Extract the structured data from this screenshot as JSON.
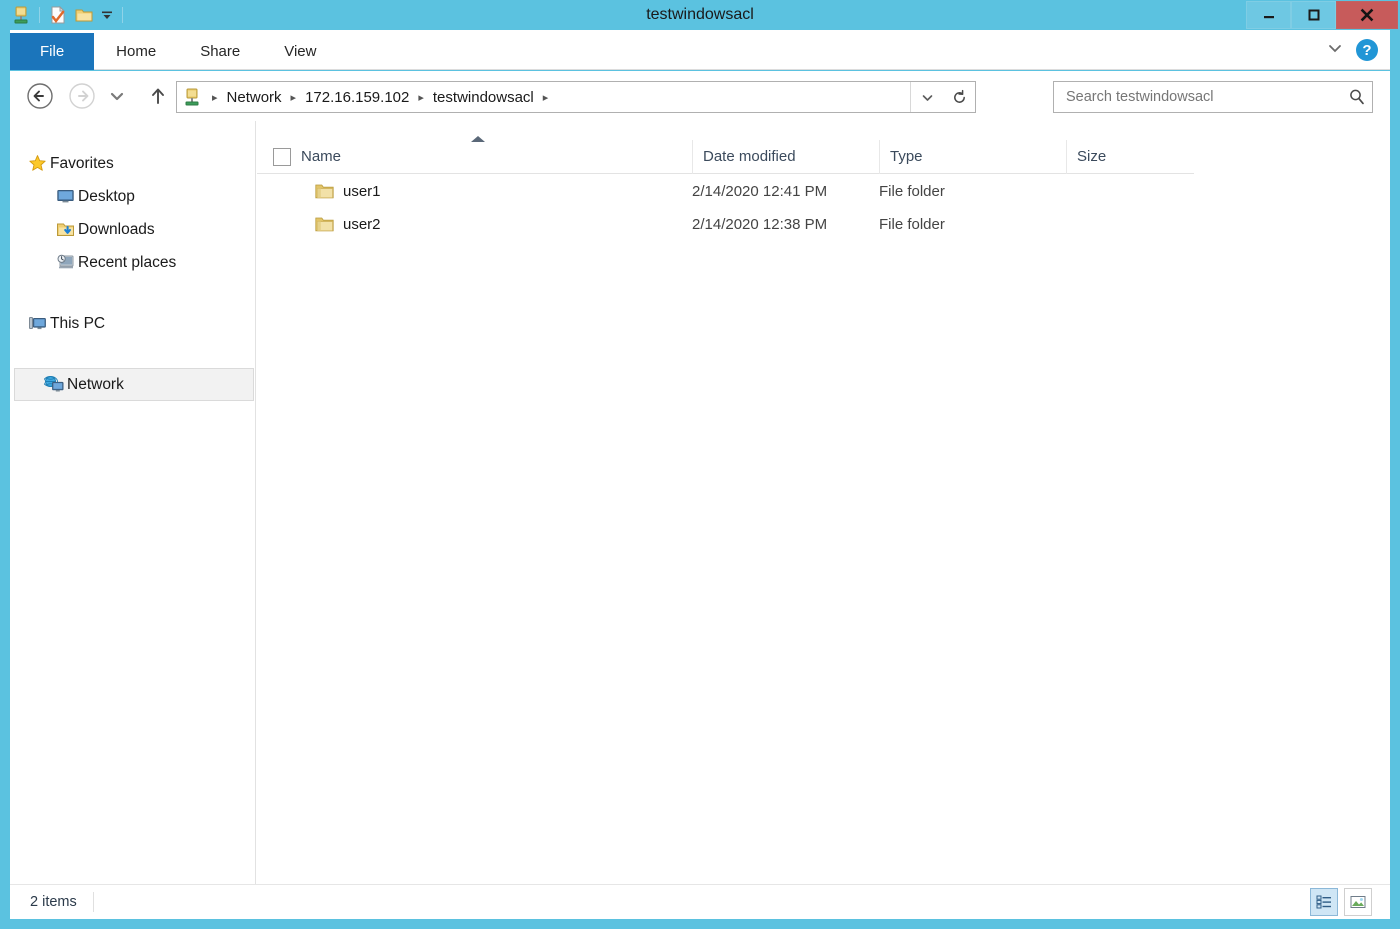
{
  "window": {
    "title": "testwindowsacl",
    "frame_color": "#5bc2e0",
    "controls": {
      "minimize": "—",
      "maximize": "❐",
      "close": "✕"
    },
    "quick_access": [
      {
        "name": "network-folder-icon",
        "label": "Network folder"
      },
      {
        "name": "properties-icon",
        "label": "Properties"
      },
      {
        "name": "new-folder-icon",
        "label": "New folder"
      },
      {
        "name": "customize-qat-caret",
        "label": "Customize Quick Access Toolbar"
      }
    ]
  },
  "ribbon": {
    "tabs": [
      {
        "label": "File",
        "active": true
      },
      {
        "label": "Home",
        "active": false
      },
      {
        "label": "Share",
        "active": false
      },
      {
        "label": "View",
        "active": false
      }
    ],
    "expand_label": "⌄",
    "help_label": "?",
    "file_tab_color": "#1b75bb"
  },
  "address": {
    "back_label": "←",
    "forward_label": "→",
    "recent_label": "▾",
    "up_label": "↑",
    "crumbs": [
      "Network",
      "172.16.159.102",
      "testwindowsacl"
    ],
    "separator": "▸",
    "trailing_separator": "▸",
    "dropdown_label": "⌄",
    "refresh_label": "⟳"
  },
  "search": {
    "placeholder": "Search testwindowsacl",
    "icon": "search-icon"
  },
  "sidebar": {
    "groups": [
      {
        "header": {
          "label": "Favorites",
          "icon": "star-icon"
        },
        "items": [
          {
            "label": "Desktop",
            "icon": "desktop-icon"
          },
          {
            "label": "Downloads",
            "icon": "downloads-icon"
          },
          {
            "label": "Recent places",
            "icon": "recent-places-icon"
          }
        ]
      },
      {
        "header": {
          "label": "This PC",
          "icon": "computer-icon"
        },
        "items": []
      },
      {
        "header": {
          "label": "Network",
          "icon": "network-icon",
          "selected": true
        },
        "items": []
      }
    ]
  },
  "filelist": {
    "columns": [
      {
        "label": "Name",
        "sorted": "asc"
      },
      {
        "label": "Date modified"
      },
      {
        "label": "Type"
      },
      {
        "label": "Size"
      }
    ],
    "rows": [
      {
        "name": "user1",
        "date": "2/14/2020 12:41 PM",
        "type": "File folder",
        "size": "",
        "icon": "folder-icon"
      },
      {
        "name": "user2",
        "date": "2/14/2020 12:38 PM",
        "type": "File folder",
        "size": "",
        "icon": "folder-icon"
      }
    ]
  },
  "status": {
    "item_count": "2 items",
    "views": [
      {
        "name": "details-view-button",
        "active": true
      },
      {
        "name": "large-icons-view-button",
        "active": false
      }
    ]
  }
}
